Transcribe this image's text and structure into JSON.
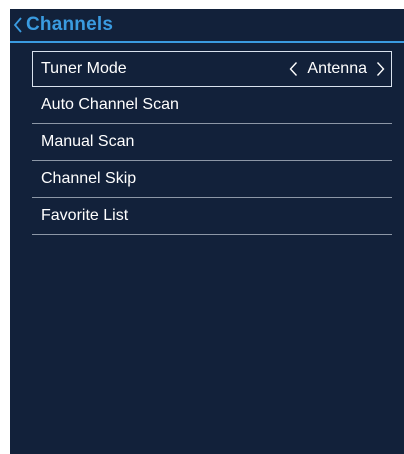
{
  "header": {
    "title": "Channels",
    "back_icon": "chevron-left-icon"
  },
  "colors": {
    "background": "#12213a",
    "accent": "#3a9be0",
    "text": "#ffffff",
    "selection_border": "#d9e2ee",
    "divider": "#8c97a6"
  },
  "menu": {
    "items": [
      {
        "label": "Tuner Mode",
        "value": "Antenna",
        "selected": true,
        "icons": [
          "chevron-left-icon",
          "chevron-right-icon"
        ]
      },
      {
        "label": "Auto Channel Scan"
      },
      {
        "label": "Manual Scan"
      },
      {
        "label": "Channel Skip"
      },
      {
        "label": "Favorite List"
      }
    ]
  }
}
